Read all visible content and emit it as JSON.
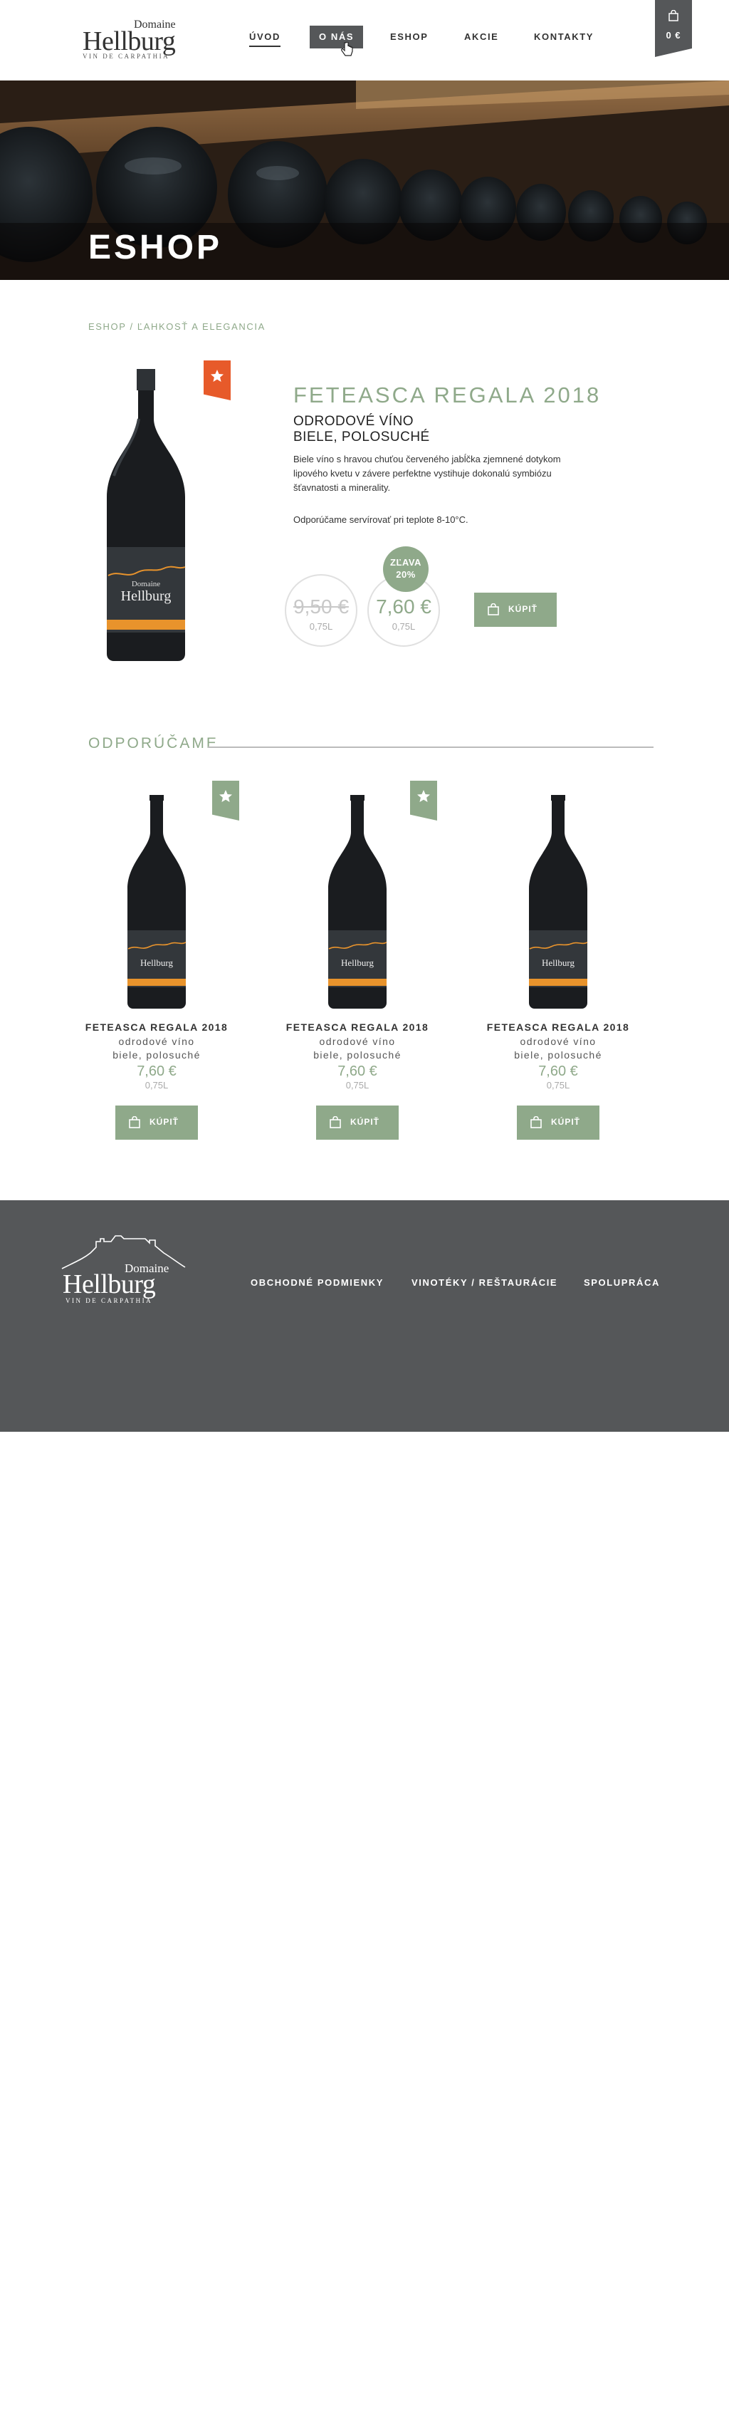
{
  "header": {
    "logo": {
      "line1": "Domaine",
      "line2": "Hellburg",
      "line3": "VIN DE CARPATHIA"
    },
    "nav": [
      {
        "label": "ÚVOD",
        "name": "nav-uvod"
      },
      {
        "label": "O NÁS",
        "name": "nav-o-nas"
      },
      {
        "label": "ESHOP",
        "name": "nav-eshop"
      },
      {
        "label": "AKCIE",
        "name": "nav-akcie"
      },
      {
        "label": "KONTAKTY",
        "name": "nav-kontakty"
      }
    ],
    "cart_total": "0 €"
  },
  "hero": {
    "title": "ESHOP"
  },
  "breadcrumb": "ESHOP / ĽAHKOSŤ A ELEGANCIA",
  "product": {
    "title": "FETEASCA REGALA 2018",
    "subtitle1": "ODRODOVÉ VÍNO",
    "subtitle2": "BIELE, POLOSUCHÉ",
    "description": "Biele víno s hravou chuťou červeného jabĺčka zjemnené dotykom lipového kvetu v závere perfektne vystihuje dokonalú symbiózu šťavnatosti a minerality.",
    "serve": "Odporúčame servírovať pri teplote 8-10°C.",
    "old_price": "9,50 €",
    "new_price": "7,60 €",
    "volume": "0,75L",
    "discount_line1": "ZĽAVA",
    "discount_line2": "20%",
    "buy_label": "KÚPIŤ",
    "bottle_label": {
      "brand1": "Domaine",
      "brand2": "Hellburg"
    }
  },
  "recommended": {
    "title": "ODPORÚČAME",
    "items": [
      {
        "name": "FETEASCA REGALA 2018",
        "line1": "odrodové víno",
        "line2": "biele, polosuché",
        "price": "7,60 €",
        "volume": "0,75L",
        "buy_label": "KÚPIŤ"
      },
      {
        "name": "FETEASCA REGALA 2018",
        "line1": "odrodové víno",
        "line2": "biele, polosuché",
        "price": "7,60 €",
        "volume": "0,75L",
        "buy_label": "KÚPIŤ"
      },
      {
        "name": "FETEASCA REGALA 2018",
        "line1": "odrodové víno",
        "line2": "biele, polosuché",
        "price": "7,60 €",
        "volume": "0,75L",
        "buy_label": "KÚPIŤ"
      }
    ]
  },
  "footer": {
    "logo": {
      "line1": "Domaine",
      "line2": "Hellburg",
      "line3": "VIN DE CARPATHIA"
    },
    "links": [
      "OBCHODNÉ PODMIENKY",
      "VINOTÉKY / REŠTAURÁCIE",
      "SPOLUPRÁCA"
    ]
  },
  "colors": {
    "accent_green": "#8fa98a",
    "dark_gray": "#555759",
    "flag_orange": "#e75a2a"
  }
}
